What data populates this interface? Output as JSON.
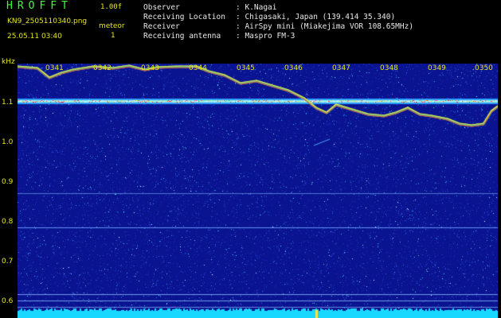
{
  "header": {
    "logo": "HROFFT",
    "version": "1.00f",
    "filename": "KN9_2505110340.png",
    "meteor_label": "meteor",
    "meteor_count": "1",
    "datetime": "25.05.11 03:40"
  },
  "info": [
    {
      "label": "Observer",
      "value": ": K.Nagai"
    },
    {
      "label": "Receiving Location",
      "value": ": Chigasaki, Japan (139.414 35.340)"
    },
    {
      "label": "Receiver",
      "value": ": AirSpy mini (Miakejima VOR 108.65MHz)"
    },
    {
      "label": "Receiving antenna",
      "value": ": Maspro FM-3"
    }
  ],
  "chart_data": {
    "type": "heatmap",
    "ylabel": "kHz",
    "y_ticks": [
      "1.1",
      "1.0",
      "0.9",
      "0.8",
      "0.7",
      "0.6"
    ],
    "time_ticks": [
      "0341",
      "0342",
      "0343",
      "0344",
      "0345",
      "0346",
      "0347",
      "0348",
      "0349",
      "0350"
    ],
    "colors": {
      "background": "#0a1490",
      "signal": "#ff3a1a",
      "text": "#e6e61a"
    }
  }
}
